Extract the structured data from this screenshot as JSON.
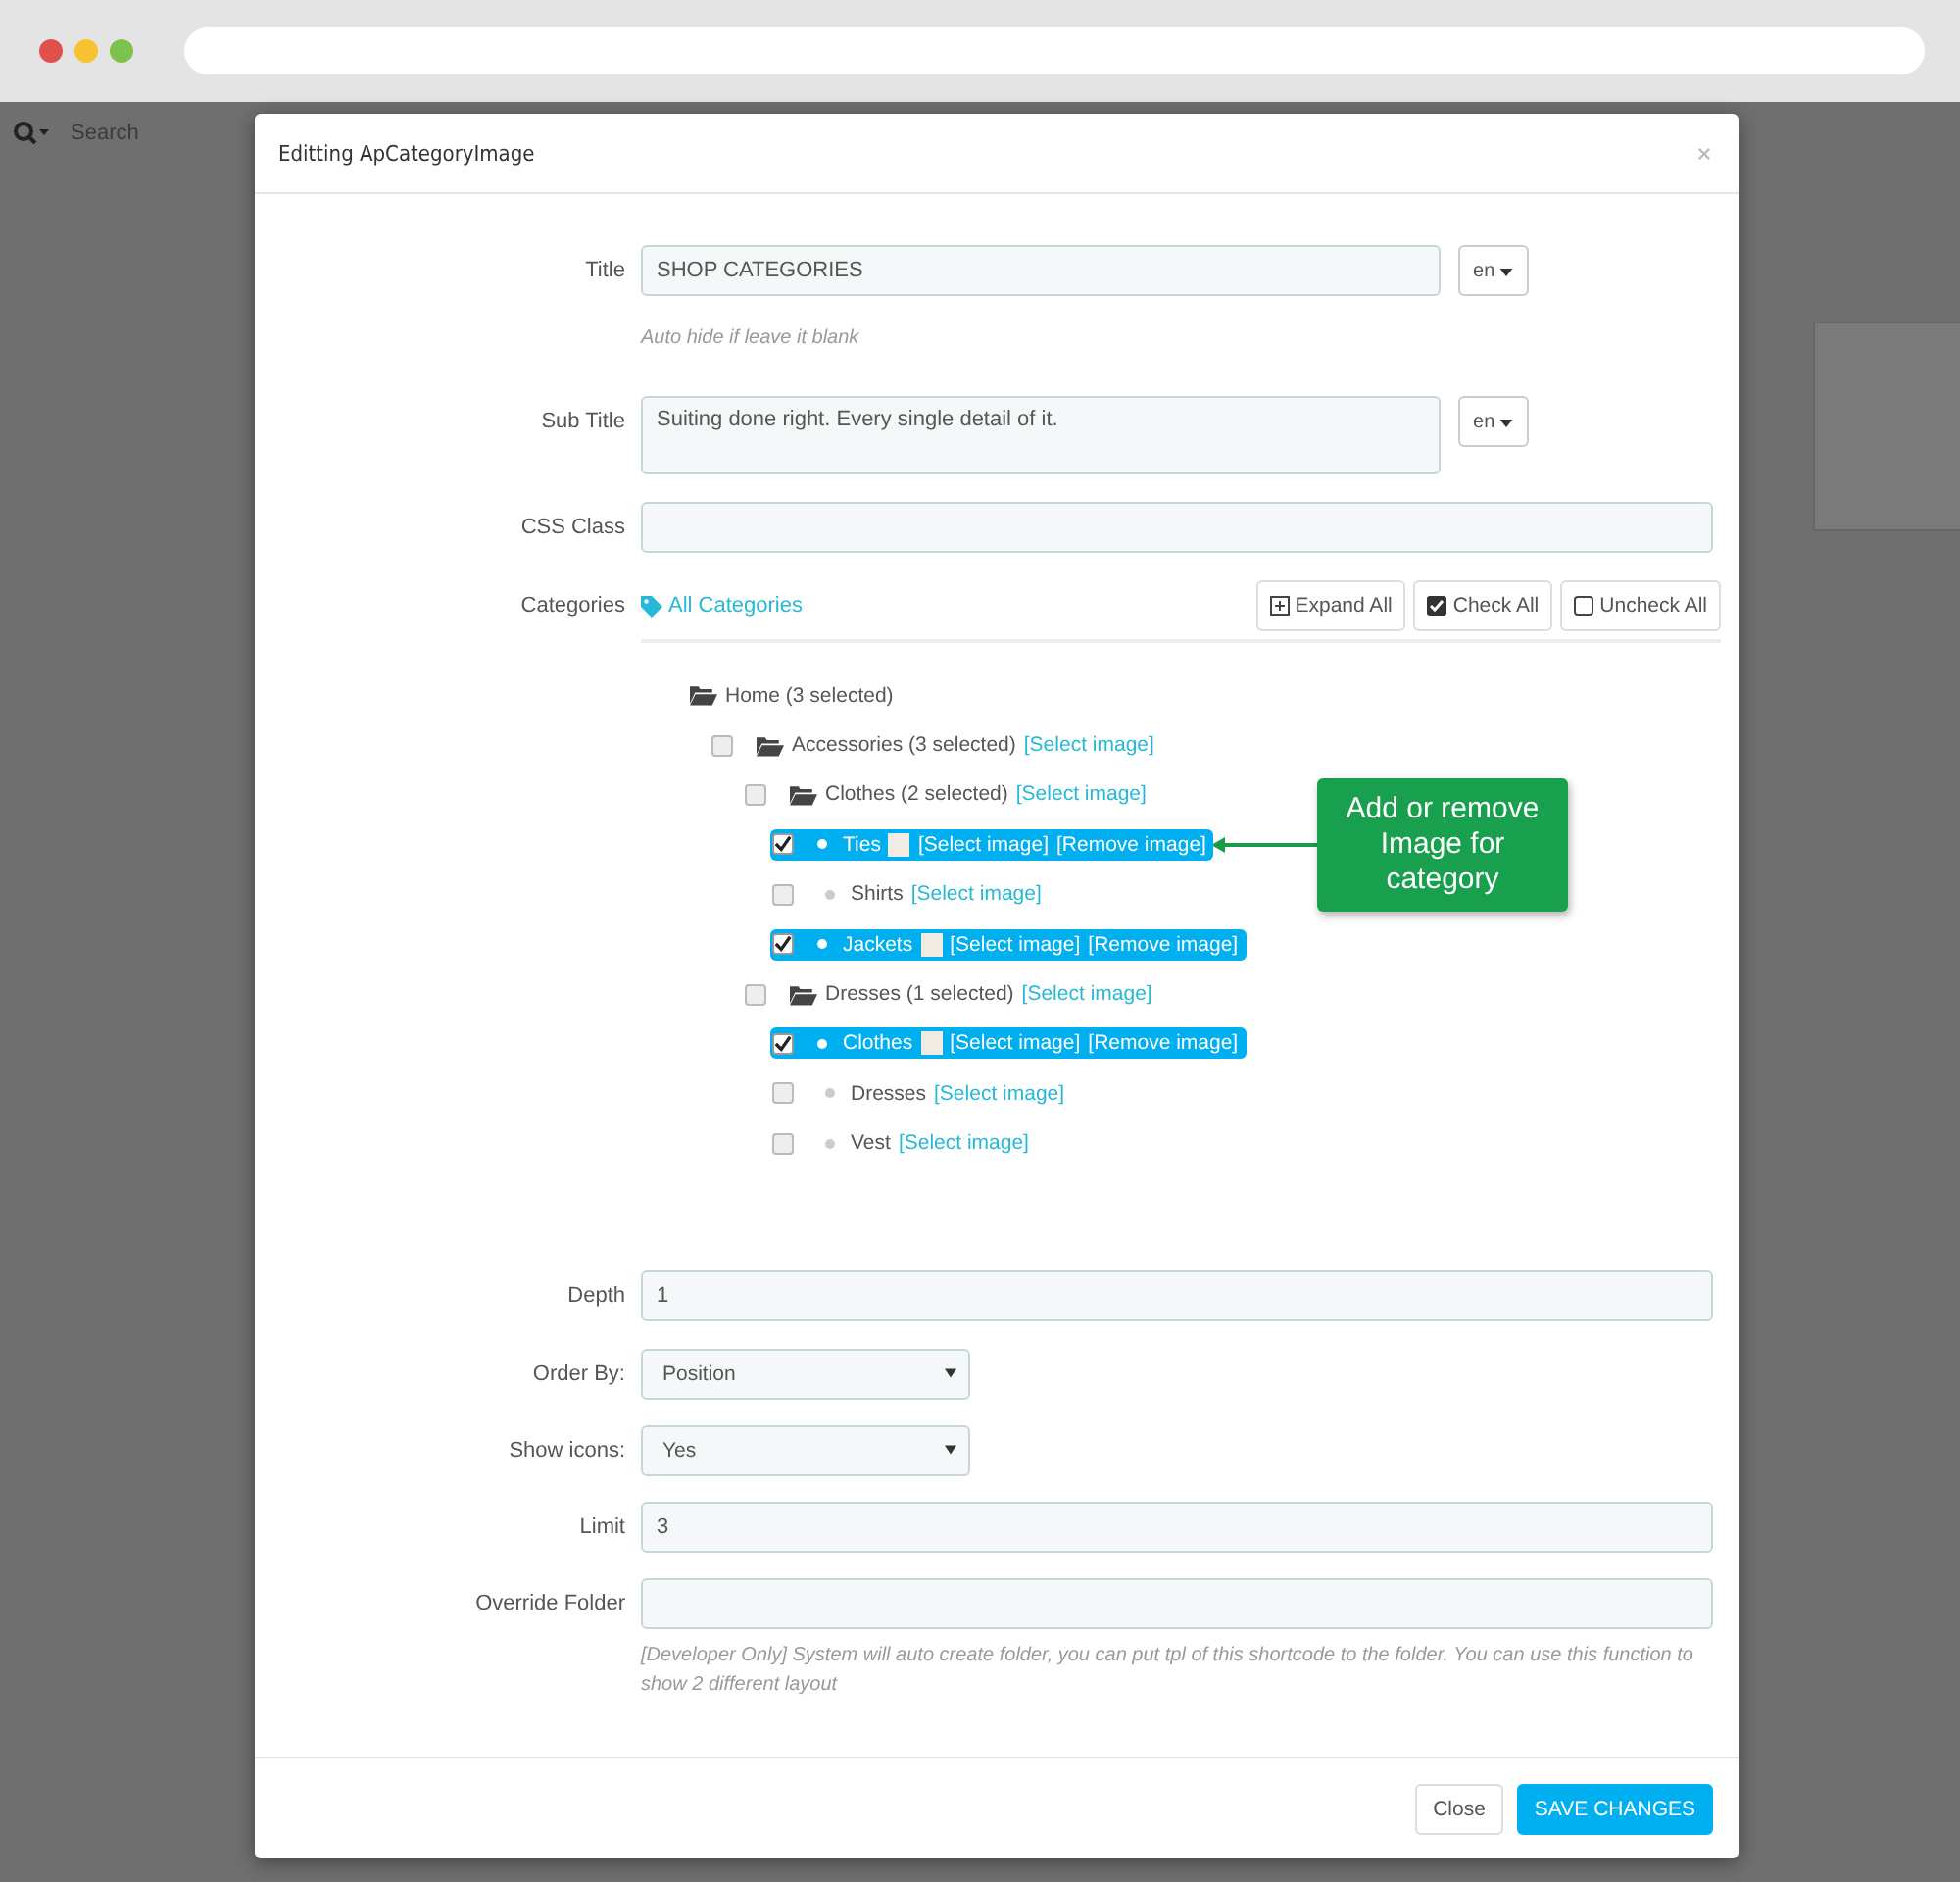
{
  "background": {
    "search_placeholder": "Search"
  },
  "modal": {
    "title": "Editting ApCategoryImage",
    "title_field": {
      "label": "Title",
      "value": "SHOP CATEGORIES",
      "language": "en",
      "help": "Auto hide if leave it blank"
    },
    "subtitle_field": {
      "label": "Sub Title",
      "value": "Suiting done right. Every single detail of it.",
      "language": "en"
    },
    "css_class_field": {
      "label": "CSS Class"
    },
    "categories": {
      "label": "Categories",
      "all_link": "All Categories",
      "buttons": [
        {
          "kind": "expand",
          "label": "Expand All"
        },
        {
          "kind": "check",
          "label": "Check All"
        },
        {
          "kind": "uncheck",
          "label": "Uncheck All"
        }
      ],
      "tree": [
        {
          "kind": "root",
          "label": "Home (3 selected)",
          "children": [
            {
              "kind": "folder",
              "label": "Accessories (3 selected)",
              "checked": false,
              "links": [
                "[Select image]"
              ],
              "children": [
                {
                  "kind": "folder",
                  "label": "Clothes (2 selected)",
                  "checked": false,
                  "links": [
                    "[Select image]"
                  ],
                  "children": [
                    {
                      "kind": "leaf",
                      "label": "Ties",
                      "checked": true,
                      "has_image": true,
                      "links": [
                        "[Select image]",
                        "[Remove image]"
                      ]
                    },
                    {
                      "kind": "leaf",
                      "label": "Shirts",
                      "checked": false,
                      "has_image": false,
                      "links": [
                        "[Select image]"
                      ]
                    },
                    {
                      "kind": "leaf",
                      "label": "Jackets",
                      "checked": true,
                      "has_image": true,
                      "links": [
                        "[Select image]",
                        "[Remove image]"
                      ]
                    }
                  ]
                },
                {
                  "kind": "folder",
                  "label": "Dresses (1 selected)",
                  "checked": false,
                  "links": [
                    "[Select image]"
                  ],
                  "children": [
                    {
                      "kind": "leaf",
                      "label": "Clothes",
                      "checked": true,
                      "has_image": true,
                      "links": [
                        "[Select image]",
                        "[Remove image]"
                      ]
                    },
                    {
                      "kind": "leaf",
                      "label": "Dresses",
                      "checked": false,
                      "has_image": false,
                      "links": [
                        "[Select image]"
                      ]
                    },
                    {
                      "kind": "leaf",
                      "label": "Vest",
                      "checked": false,
                      "has_image": false,
                      "links": [
                        "[Select image]"
                      ]
                    }
                  ]
                }
              ]
            }
          ]
        }
      ]
    },
    "callout": "Add or remove Image for category",
    "depth_field": {
      "label": "Depth",
      "value": "1"
    },
    "order_by_field": {
      "label": "Order By:",
      "value": "Position"
    },
    "show_icons_field": {
      "label": "Show icons:",
      "value": "Yes"
    },
    "limit_field": {
      "label": "Limit",
      "value": "3"
    },
    "override_folder_field": {
      "label": "Override Folder",
      "help": "[Developer Only] System will auto create folder, you can put tpl of this shortcode to the folder. You can use this function to show 2 different layout"
    },
    "footer_buttons": [
      {
        "kind": "secondary",
        "label": "Close"
      },
      {
        "kind": "primary",
        "label": "SAVE CHANGES"
      }
    ]
  }
}
